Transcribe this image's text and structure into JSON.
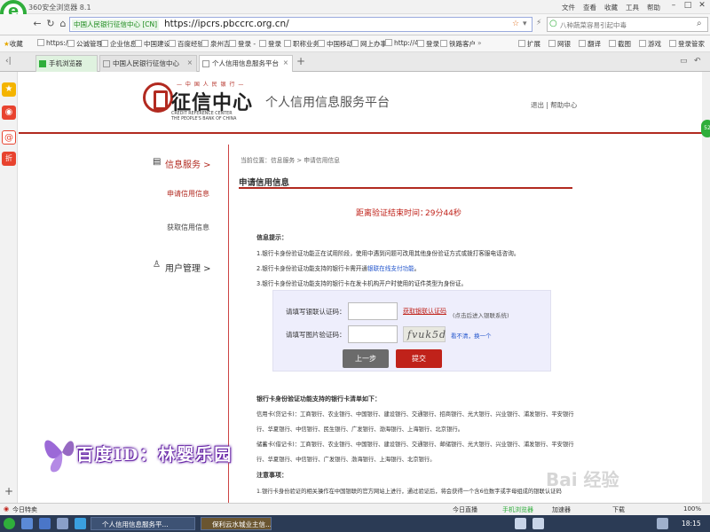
{
  "window": {
    "title": "360安全浏览器 8.1",
    "menu": [
      "文件",
      "查看",
      "收藏",
      "工具",
      "帮助"
    ]
  },
  "nav": {
    "cert_label": "中国人民银行征信中心 [CN]",
    "url": "https://ipcrs.pbccrc.org.cn/",
    "search_placeholder": "八种蔬菜容易引起中毒"
  },
  "bookmarks": [
    "收藏",
    "https://",
    "公诚管理",
    "企业信息",
    "中国建设",
    "百度经验",
    "泉州吉",
    "登录 -",
    "登录",
    "职称业务",
    "中国移动",
    "网上办事",
    "http://4",
    "登录",
    "铁路客户"
  ],
  "bookmarks_right": [
    "扩展",
    "网银",
    "翻译",
    "截图",
    "游戏",
    "登录管家"
  ],
  "tabs": [
    {
      "label": "手机浏览器"
    },
    {
      "label": "中国人民银行征信中心"
    },
    {
      "label": "个人信用信息服务平台"
    }
  ],
  "header": {
    "logo_top": "— 中 国 人 民 银 行 —",
    "logo_cn": "征信中心",
    "logo_en1": "CREDIT REFERENCE CENTER",
    "logo_en2": "THE PEOPLE'S BANK OF CHINA",
    "platform": "个人信用信息服务平台",
    "links": "退出 | 帮助中心"
  },
  "sidebar": {
    "info_service": "信息服务 >",
    "apply": "申请信用信息",
    "obtain": "获取信用信息",
    "user_mgmt": "用户管理 >"
  },
  "content": {
    "breadcrumb": "当前位置：信息服务 > 申请信用信息",
    "title": "申请信用信息",
    "countdown_label": "距离验证结束时间：",
    "countdown_value": "29分44秒",
    "tips_title": "信息提示：",
    "tip1": "1.银行卡身份验证功能正在试用阶段，使用中遇到问题可改用其他身份验证方式或拨打客服电话咨询。",
    "tip2_a": "2.银行卡身份验证功能支持的银行卡需开通",
    "tip2_link": "银联在线支付功能",
    "tip2_b": "。",
    "tip3": "3.银行卡身份验证功能支持的银行卡在发卡机构开户时使用的证件类型为身份证。",
    "label_unionpay": "请填写银联认证码：",
    "get_code": "获取银联认证码",
    "get_code_hint": "(点击后进入银联系统)",
    "label_captcha": "请填写图片验证码：",
    "captcha_text": "fvuk5d",
    "captcha_refresh_a": "看不清，",
    "captcha_refresh_b": "换一个",
    "btn_prev": "上一步",
    "btn_submit": "提交",
    "banks_title": "银行卡身份验证功能支持的银行卡清单如下：",
    "credit_line1": "信用卡(贷记卡)：工商银行、农业银行、中国银行、建设银行、交通银行、招商银行、光大银行、兴业银行、浦发银行、平安银行",
    "credit_line2": "行、华夏银行、中信银行、民生银行、广发银行、渤海银行、上海银行、北京银行。",
    "debit_line1": "储蓄卡(借记卡)：工商银行、农业银行、中国银行、建设银行、交通银行、邮储银行、光大银行、兴业银行、浦发银行、平安银行",
    "debit_line2": "行、华夏银行、中信银行、广发银行、渤海银行、上海银行、北京银行。",
    "notes_title": "注意事项：",
    "note1": "1.银行卡身份验证的相关操作在中国银联的官方网站上进行，通过验证后，将会获得一个含6位数字或字母组成的银联认证码"
  },
  "watermark": {
    "text": "百度ID：林婴乐园",
    "baidu": "Bai 经验"
  },
  "status": {
    "left": "今日特卖",
    "right": [
      "今日直播",
      "手机浏览器",
      "加速器",
      "下载",
      "100%"
    ]
  },
  "taskbar": {
    "items": [
      "个人信用信息服务平...",
      "保利云水城业主信..."
    ],
    "time": "18:15"
  }
}
